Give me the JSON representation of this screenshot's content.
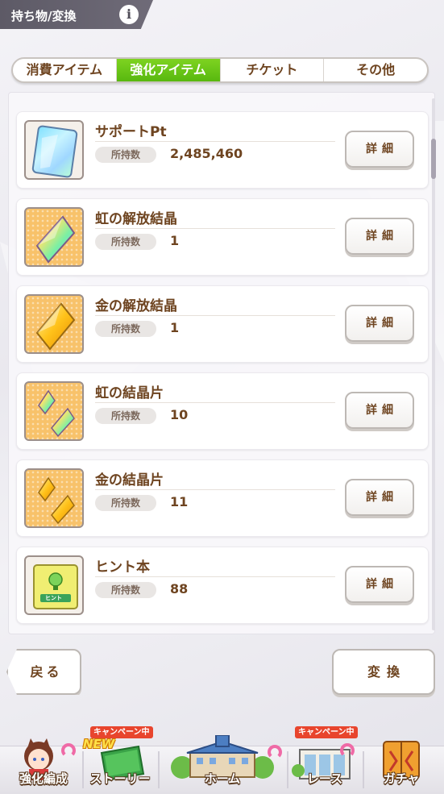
{
  "header": {
    "title": "持ち物/変換",
    "info_icon": "info-icon"
  },
  "tabs": [
    {
      "label": "消費アイテム",
      "active": false
    },
    {
      "label": "強化アイテム",
      "active": true
    },
    {
      "label": "チケット",
      "active": false
    },
    {
      "label": "その他",
      "active": false
    }
  ],
  "qty_label": "所持数",
  "detail_label": "詳細",
  "items": [
    {
      "name": "サポートPt",
      "qty": "2,485,460",
      "icon": "support-pt-card-icon"
    },
    {
      "name": "虹の解放結晶",
      "qty": "1",
      "icon": "rainbow-crystal-icon"
    },
    {
      "name": "金の解放結晶",
      "qty": "1",
      "icon": "gold-crystal-icon"
    },
    {
      "name": "虹の結晶片",
      "qty": "10",
      "icon": "rainbow-shards-icon"
    },
    {
      "name": "金の結晶片",
      "qty": "11",
      "icon": "gold-shards-icon"
    },
    {
      "name": "ヒント本",
      "qty": "88",
      "icon": "hint-book-icon",
      "book_label": "ヒント"
    }
  ],
  "buttons": {
    "back": "戻る",
    "convert": "変換"
  },
  "nav": {
    "items": [
      {
        "label": "強化編成",
        "icon": "character-icon"
      },
      {
        "label": "ストーリー",
        "icon": "story-book-icon",
        "badge": "キャンペーン中",
        "new": "NEW"
      },
      {
        "label": "ホーム",
        "icon": "school-building-icon"
      },
      {
        "label": "レース",
        "icon": "race-gate-icon",
        "badge": "キャンペーン中"
      },
      {
        "label": "ガチャ",
        "icon": "gacha-door-icon"
      }
    ]
  },
  "colors": {
    "accent": "#7ed321",
    "text": "#6e4420",
    "campaign": "#e8452d"
  }
}
